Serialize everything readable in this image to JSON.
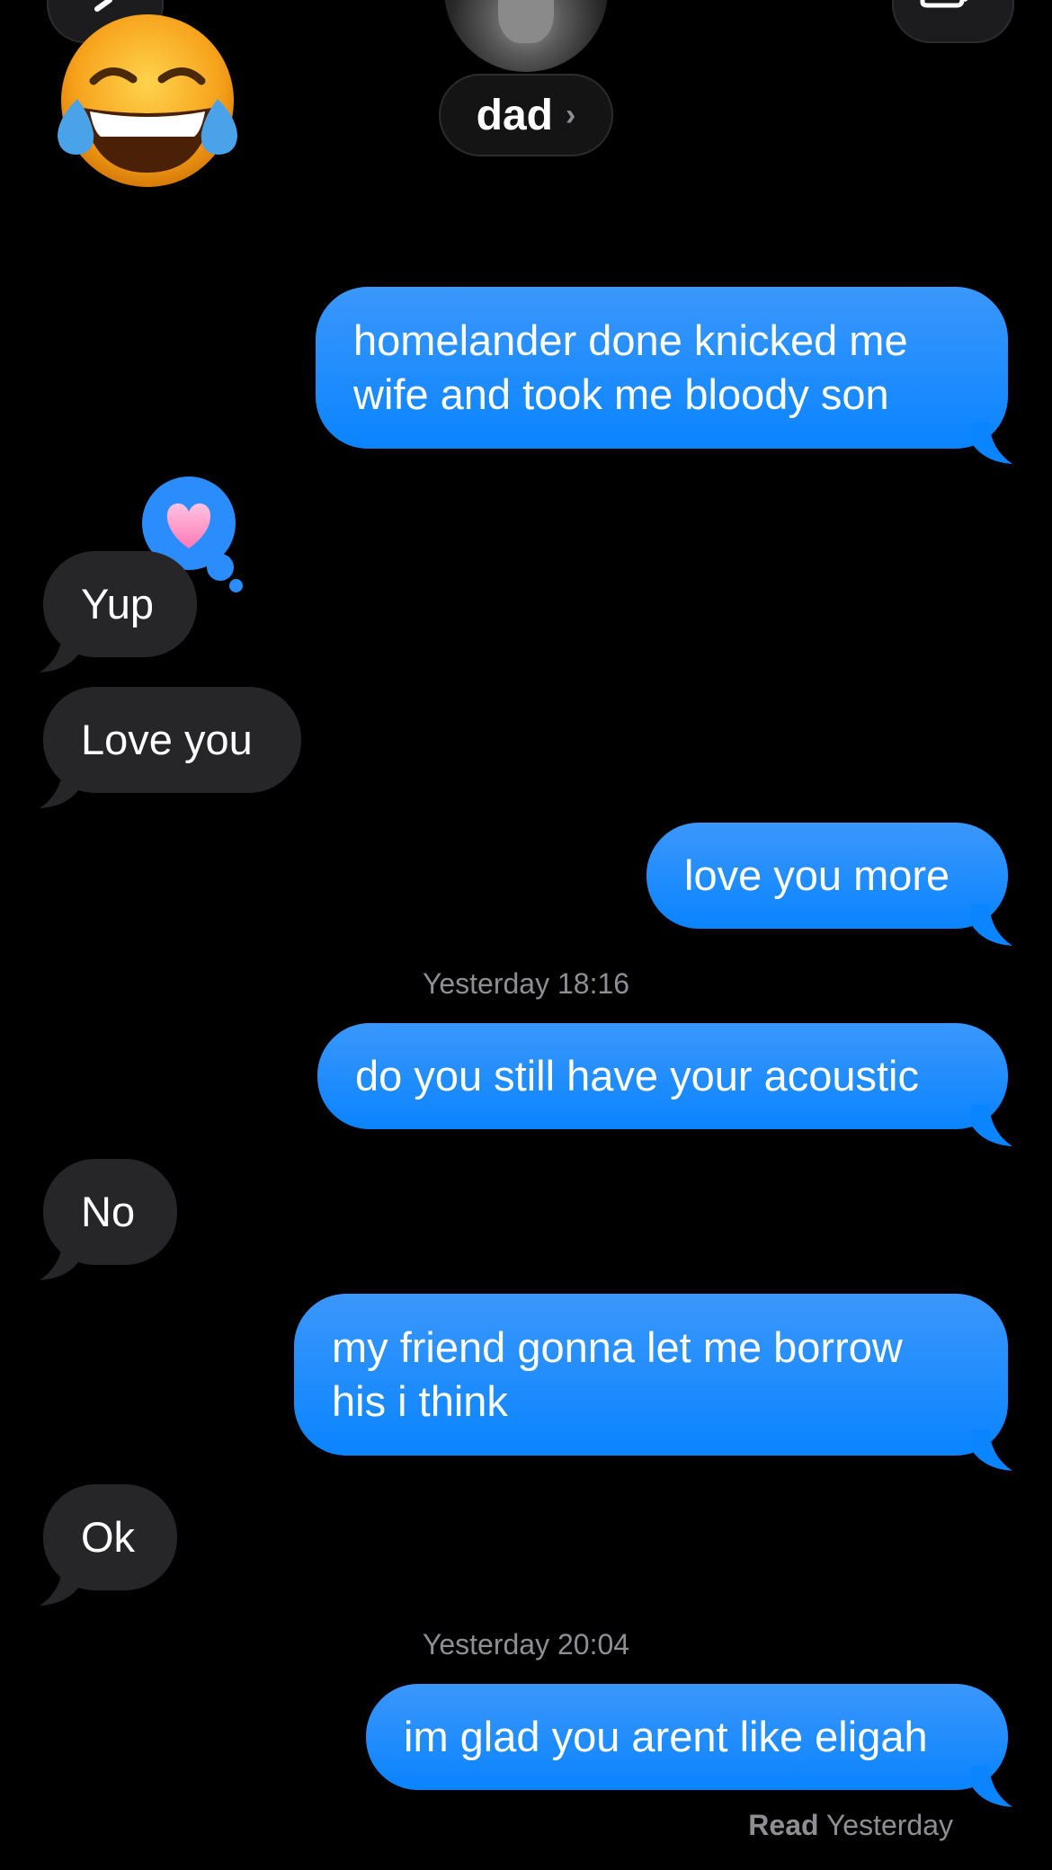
{
  "header": {
    "contact_name": "dad",
    "chevron": "›",
    "back_icon": "chevron-left-icon",
    "video_icon": "video-camera-icon",
    "reaction_emoji": "face-with-tears-of-joy"
  },
  "messages": [
    {
      "from": "me",
      "text_lines": [
        "homelander done knicked me",
        "wife and took me bloody son"
      ]
    },
    {
      "from": "them",
      "text": "Yup",
      "tapback": "heart"
    },
    {
      "from": "them",
      "text": "Love you"
    },
    {
      "from": "me",
      "text": "love you more"
    },
    {
      "timestamp_day": "Yesterday",
      "timestamp_time": "18:16"
    },
    {
      "from": "me",
      "text": "do you still have your acoustic"
    },
    {
      "from": "them",
      "text": "No"
    },
    {
      "from": "me",
      "text_lines": [
        "my friend gonna let me borrow",
        "his i think"
      ]
    },
    {
      "from": "them",
      "text": "Ok"
    },
    {
      "timestamp_day": "Yesterday",
      "timestamp_time": "20:04"
    },
    {
      "from": "me",
      "text": "im glad you arent like eligah"
    }
  ],
  "read_receipt": {
    "label": "Read",
    "time": "Yesterday"
  },
  "colors": {
    "background": "#000000",
    "outgoing_bubble": "#0a84ff",
    "incoming_bubble": "#262628",
    "meta_text": "#8e8e93"
  }
}
